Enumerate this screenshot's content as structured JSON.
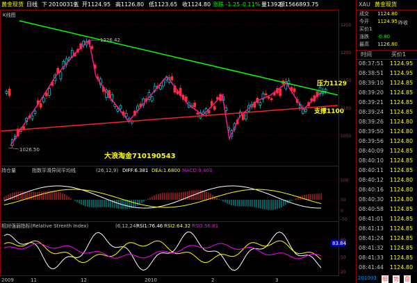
{
  "header": {
    "name": "黄金现货",
    "period": "日线",
    "down_label": "下",
    "date": "20100319",
    "weekday": "五",
    "open": "开1124.95",
    "high": "高1126.80",
    "low": "低1123.65",
    "close": "收1124.80",
    "change": "涨跌 -1.25",
    "pct": "-0.11%",
    "volume": "量1392",
    "amount": "额1566893.75"
  },
  "main_chart": {
    "label": "K线图",
    "annot_high": "1226.42",
    "annot_low": "1026.50",
    "resistance": "压力1129",
    "support": "支撑1100",
    "watermark": "大浪淘金710190543",
    "y_ticks": [
      "1250",
      "1200",
      "1150",
      "1100",
      "1050"
    ]
  },
  "macd_panel": {
    "label": "持仓量",
    "title": "指数平滑异同平均线",
    "params": "(26,12,9)",
    "diff": "DIFF:6.381",
    "dea": "DEA:1.6800",
    "macd": "MACD:9.403",
    "y_ticks": [
      "100",
      "50",
      "0",
      "-50"
    ]
  },
  "rsi_panel": {
    "title": "相对强弱指标(Relative Strenth Index)",
    "params": "(6,12,24)",
    "rsi1": "RSI1:76.46",
    "rsi2": "RSI2:64.32",
    "rsi3": "RSI3:56.81",
    "badge": "83.84",
    "y_ticks": [
      "80",
      "50",
      "20"
    ]
  },
  "x_axis": {
    "labels": [
      "2009",
      "11",
      "12",
      "2010",
      "2",
      "3"
    ]
  },
  "sidebar": {
    "symbol": "XAU",
    "name": "黄金现货",
    "rows": [
      {
        "label": "成交",
        "value": "1124.80"
      },
      {
        "label": "今开",
        "value": "1124.95"
      },
      {
        "label": "买价1",
        "value": ""
      },
      {
        "label": "涨跌",
        "value": "-0.80"
      },
      {
        "label": "最高",
        "value": "1126.80"
      }
    ],
    "extra_label": "昨收",
    "tick_header_time": "时间",
    "tick_header_price": "买价1",
    "ticks": [
      {
        "time": "08:37:51",
        "price": "1124.95"
      },
      {
        "time": "08:38:51",
        "price": "1124.95"
      },
      {
        "time": "08:39:10",
        "price": "1124.85"
      },
      {
        "time": "08:39:20",
        "price": "1124.85"
      },
      {
        "time": "08:39:21",
        "price": "1124.85"
      },
      {
        "time": "08:39:24",
        "price": "1124.85"
      },
      {
        "time": "08:39:26",
        "price": "1124.80"
      },
      {
        "time": "08:39:50",
        "price": "1124.80"
      },
      {
        "time": "08:39:56",
        "price": "1124.80"
      },
      {
        "time": "08:40:09",
        "price": "1124.85"
      },
      {
        "time": "08:40:10",
        "price": "1124.85"
      },
      {
        "time": "08:40:11",
        "price": "1124.85"
      },
      {
        "time": "08:40:12",
        "price": "1124.80"
      },
      {
        "time": "08:40:16",
        "price": "1124.80"
      },
      {
        "time": "08:40:30",
        "price": "1124.80"
      },
      {
        "time": "08:40:58",
        "price": "1124.85"
      },
      {
        "time": "08:41:01",
        "price": "1124.85"
      },
      {
        "time": "08:41:13",
        "price": "1124.85"
      },
      {
        "time": "08:41:24",
        "price": "1124.85"
      },
      {
        "time": "08:41:32",
        "price": "1124.85"
      },
      {
        "time": "08:41:33",
        "price": "1124.85"
      },
      {
        "time": "08:41:44",
        "price": "1124.80"
      }
    ],
    "bottom_code": "201003",
    "bottom_buttons": [
      "细",
      "势",
      "盘"
    ],
    "colors": {
      "up": "#00ffff",
      "down": "#ff3030",
      "price": "#ffff00",
      "frame": "#8b0000"
    }
  }
}
